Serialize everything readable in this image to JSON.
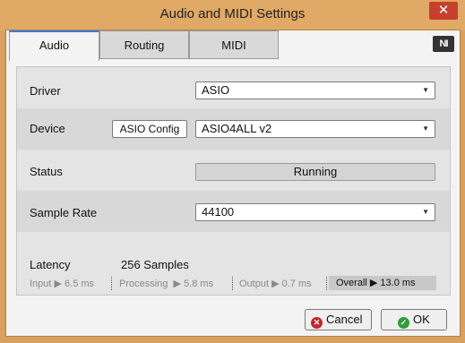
{
  "window": {
    "title": "Audio and MIDI Settings",
    "close_glyph": "✕"
  },
  "tabs": [
    {
      "label": "Audio",
      "active": true
    },
    {
      "label": "Routing",
      "active": false
    },
    {
      "label": "MIDI",
      "active": false
    }
  ],
  "logo": {
    "text": "NI"
  },
  "settings": {
    "driver": {
      "label": "Driver",
      "value": "ASIO"
    },
    "device": {
      "label": "Device",
      "config_button": "ASIO Config",
      "value": "ASIO4ALL v2"
    },
    "status": {
      "label": "Status",
      "value": "Running"
    },
    "sample_rate": {
      "label": "Sample Rate",
      "value": "44100"
    }
  },
  "latency": {
    "label": "Latency",
    "value": "256 Samples",
    "input_label": "Input",
    "input_value": "6.5 ms",
    "processing_label": "Processing",
    "processing_value": "5.8 ms",
    "output_label": "Output",
    "output_value": "0.7 ms",
    "overall_label": "Overall",
    "overall_value": "13.0 ms"
  },
  "footer": {
    "cancel_label": "Cancel",
    "ok_label": "OK"
  },
  "colors": {
    "accent": "#3a7bd5",
    "titlebar": "#e0a966",
    "cancel_icon": "#c62828",
    "ok_icon": "#2e9d3a"
  }
}
